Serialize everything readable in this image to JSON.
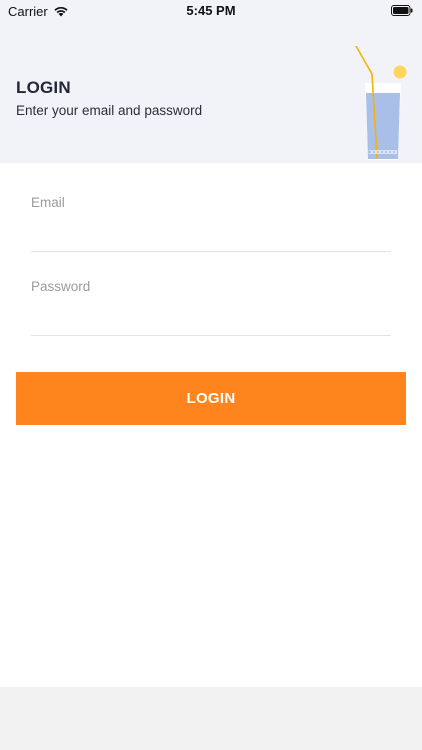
{
  "status_bar": {
    "carrier": "Carrier",
    "time": "5:45 PM",
    "wifi_icon": "wifi-icon",
    "battery_icon": "battery-icon"
  },
  "header": {
    "title": "LOGIN",
    "subtitle": "Enter your email and password",
    "illustration": "drink-glass-icon",
    "background": "#f2f3f8"
  },
  "form": {
    "email_label": "Email",
    "email_value": "",
    "password_label": "Password",
    "password_value": ""
  },
  "actions": {
    "login_label": "LOGIN",
    "login_color": "#fe841e"
  }
}
